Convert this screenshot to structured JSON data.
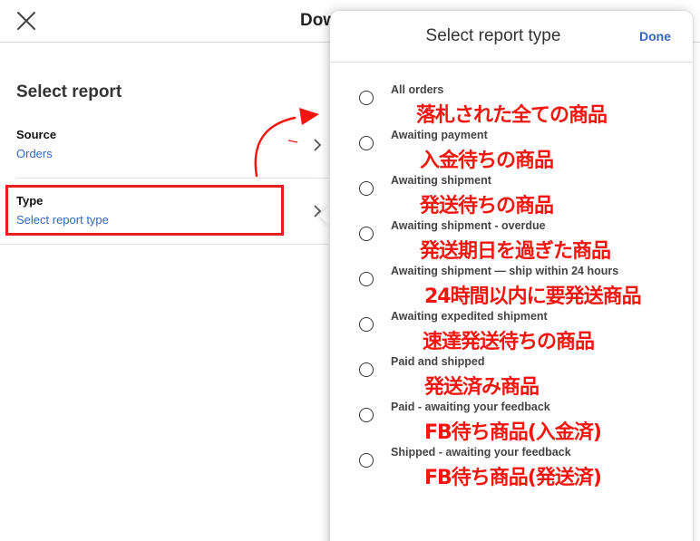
{
  "header": {
    "title": "Dow"
  },
  "main": {
    "section_heading": "Select report",
    "rows": [
      {
        "label": "Source",
        "value": "Orders"
      },
      {
        "label": "Type",
        "value": "Select report type"
      }
    ]
  },
  "panel": {
    "title": "Select report type",
    "done_label": "Done",
    "options": [
      {
        "label": "All orders",
        "annotation": "落札された全ての商品"
      },
      {
        "label": "Awaiting payment",
        "annotation": "入金待ちの商品"
      },
      {
        "label": "Awaiting shipment",
        "annotation": "発送待ちの商品"
      },
      {
        "label": "Awaiting shipment - overdue",
        "annotation": "発送期日を過ぎた商品"
      },
      {
        "label": "Awaiting shipment — ship within 24 hours",
        "annotation": "24時間以内に要発送商品"
      },
      {
        "label": "Awaiting expedited shipment",
        "annotation": "速達発送待ちの商品"
      },
      {
        "label": "Paid and shipped",
        "annotation": "発送済み商品"
      },
      {
        "label": "Paid - awaiting your feedback",
        "annotation": "FB待ち商品(入金済)"
      },
      {
        "label": "Shipped - awaiting your feedback",
        "annotation": "FB待ち商品(発送済)"
      }
    ]
  },
  "colors": {
    "link_blue": "#3665c1",
    "annotation_red": "#f2160e"
  }
}
